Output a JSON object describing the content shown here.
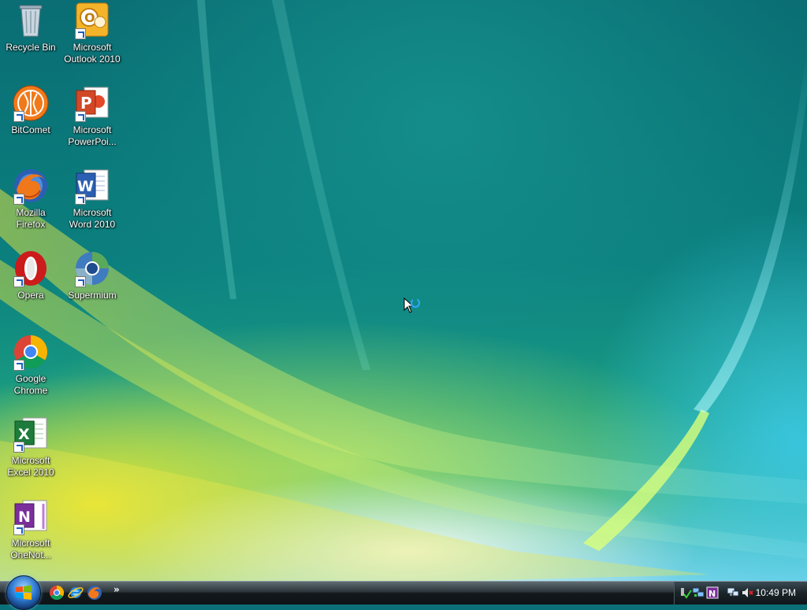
{
  "desktop": {
    "icons": [
      {
        "label": "Recycle Bin",
        "icon": "recycle-bin-icon"
      },
      {
        "label": "Microsoft\nOutlook 2010",
        "icon": "outlook-icon"
      },
      {
        "label": "BitComet",
        "icon": "bitcomet-icon"
      },
      {
        "label": "Microsoft\nPowerPoi...",
        "icon": "powerpoint-icon"
      },
      {
        "label": "Mozilla\nFirefox",
        "icon": "firefox-icon"
      },
      {
        "label": "Microsoft\nWord 2010",
        "icon": "word-icon"
      },
      {
        "label": "Opera",
        "icon": "opera-icon"
      },
      {
        "label": "Supermium",
        "icon": "supermium-icon"
      },
      {
        "label": "Google\nChrome",
        "icon": "chrome-icon"
      },
      {
        "label": "Microsoft\nExcel 2010",
        "icon": "excel-icon"
      },
      {
        "label": "Microsoft\nOneNot...",
        "icon": "onenote-icon"
      }
    ]
  },
  "taskbar": {
    "start_icon": "windows-logo-icon",
    "quick_launch": [
      {
        "icon": "chrome-icon"
      },
      {
        "icon": "internet-explorer-icon"
      },
      {
        "icon": "firefox-icon"
      }
    ],
    "overflow_label": "»",
    "tray_icons": [
      "safely-remove-hardware-icon",
      "network-status-icon",
      "onenote-tray-icon",
      "network-disconnected-icon",
      "volume-muted-icon"
    ],
    "clock": "10:49 PM"
  },
  "colors": {
    "wallpaper_base": "#0b6f78",
    "taskbar": "#12181c"
  }
}
